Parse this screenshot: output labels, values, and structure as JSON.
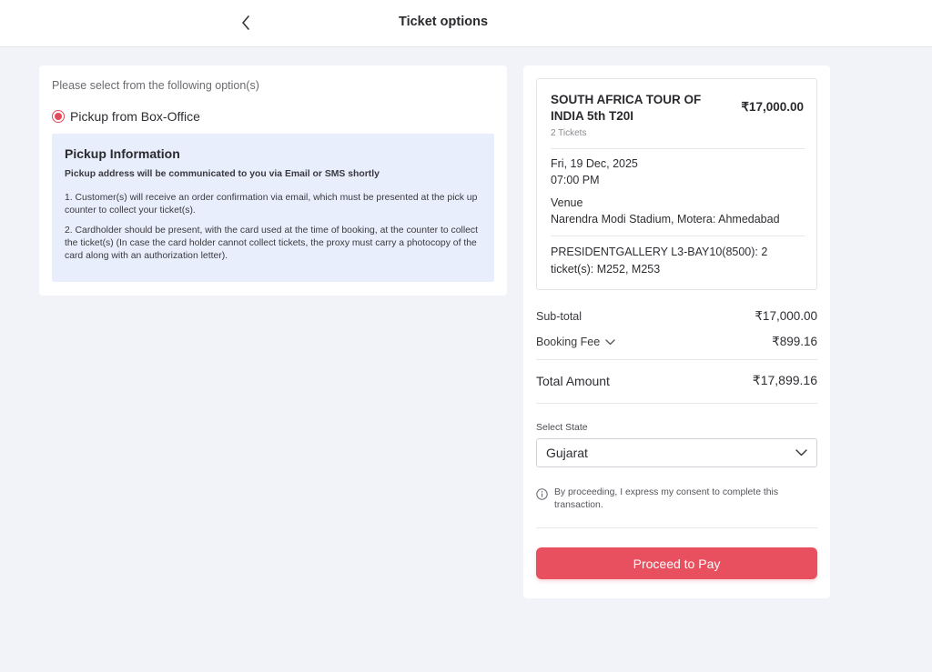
{
  "header": {
    "title": "Ticket options",
    "back_icon": "chevron-left-icon"
  },
  "delivery": {
    "instruction": "Please select from the following option(s)",
    "selected_option": "Pickup from Box-Office",
    "pickup_info": {
      "title": "Pickup Information",
      "subtitle": "Pickup address will be communicated to you via Email or SMS shortly",
      "line1": "1. Customer(s) will receive an order confirmation via email, which must be presented at the pick up counter to collect your ticket(s).",
      "line2": "2. Cardholder should be present, with the card used at the time of booking, at the counter to collect the ticket(s) (In case the card holder cannot collect tickets, the proxy must carry a photocopy of the card along with an authorization letter)."
    }
  },
  "order": {
    "event_name": "SOUTH AFRICA TOUR OF INDIA 5th T20I",
    "event_price": "₹17,000.00",
    "ticket_count": "2 Tickets",
    "date": "Fri, 19 Dec, 2025",
    "time": "07:00 PM",
    "venue_label": "Venue",
    "venue": "Narendra Modi Stadium, Motera: Ahmedabad",
    "seats": "PRESIDENTGALLERY L3-BAY10(8500): 2 ticket(s): M252, M253"
  },
  "summary": {
    "subtotal_label": "Sub-total",
    "subtotal_value": "₹17,000.00",
    "fee_label": "Booking Fee",
    "fee_value": "₹899.16",
    "total_label": "Total Amount",
    "total_value": "₹17,899.16"
  },
  "state": {
    "label": "Select State",
    "selected": "Gujarat"
  },
  "consent_text": "By proceeding, I express my consent to complete this transaction.",
  "pay_button": "Proceed to Pay",
  "colors": {
    "accent": "#e8505f",
    "info_bg": "#e8eefc",
    "page_bg": "#f1f3f8"
  }
}
